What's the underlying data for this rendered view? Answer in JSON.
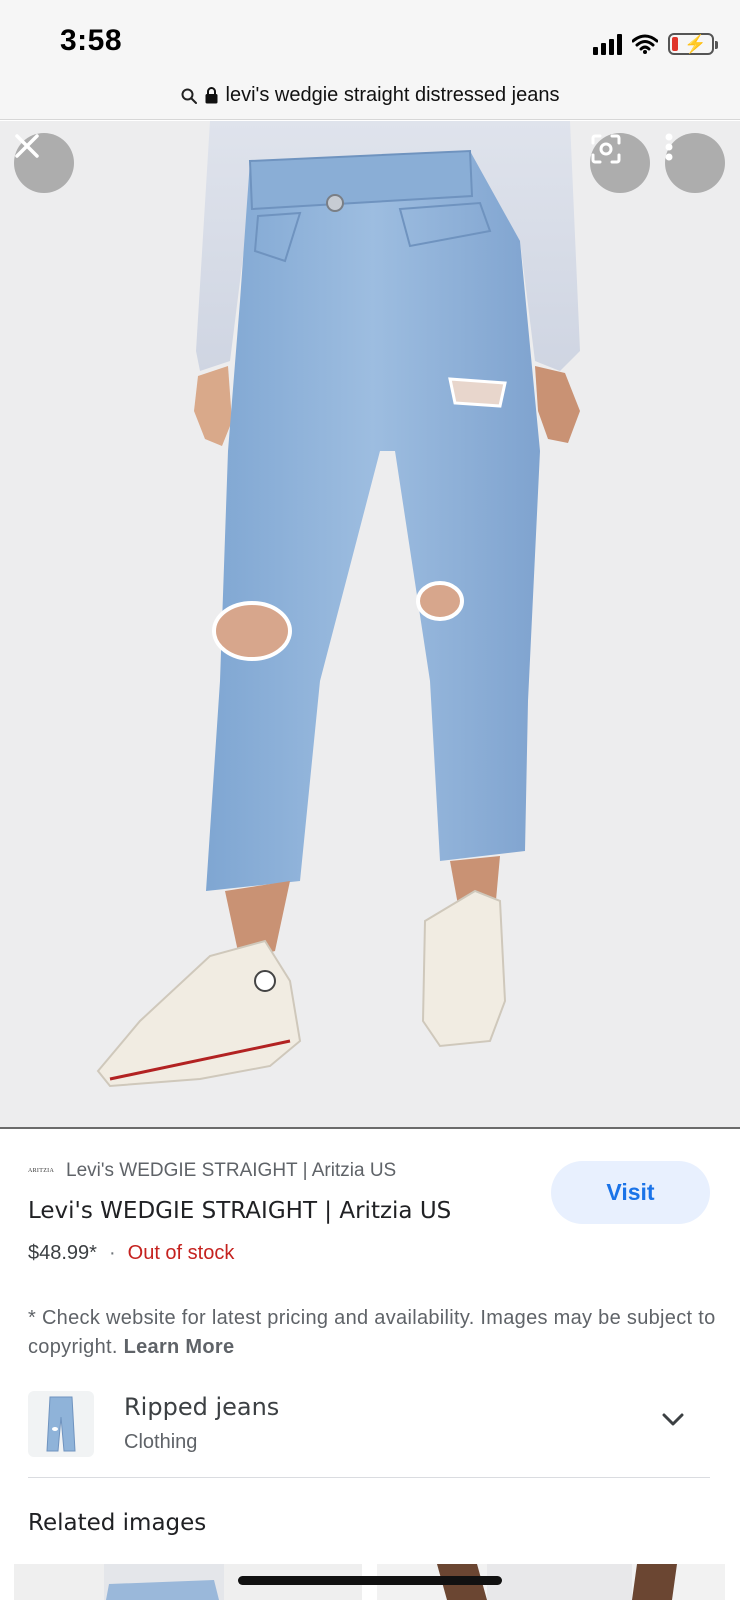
{
  "status_bar": {
    "time": "3:58"
  },
  "url_bar": {
    "text": "levi's wedgie straight distressed jeans"
  },
  "hero": {
    "close_icon": "close-icon",
    "lens_icon": "lens-icon",
    "more_icon": "more-vert-icon"
  },
  "product": {
    "source_logo": "ARITZIA",
    "source_name": "Levi's WEDGIE STRAIGHT | Aritzia US",
    "title": "Levi's WEDGIE STRAIGHT | Aritzia US",
    "price": "$48.99*",
    "separator": "·",
    "stock": "Out of stock",
    "visit_label": "Visit"
  },
  "disclaimer": {
    "text": "* Check website for latest pricing and availability. Images may be subject to copyright.",
    "learn_more": "Learn More"
  },
  "category": {
    "title": "Ripped jeans",
    "subtitle": "Clothing"
  },
  "related": {
    "title": "Related images"
  },
  "colors": {
    "visit_bg": "#e8f0fe",
    "visit_text": "#1a73e8",
    "stock_red": "#c5221f",
    "denim": "#8fb3d9"
  }
}
